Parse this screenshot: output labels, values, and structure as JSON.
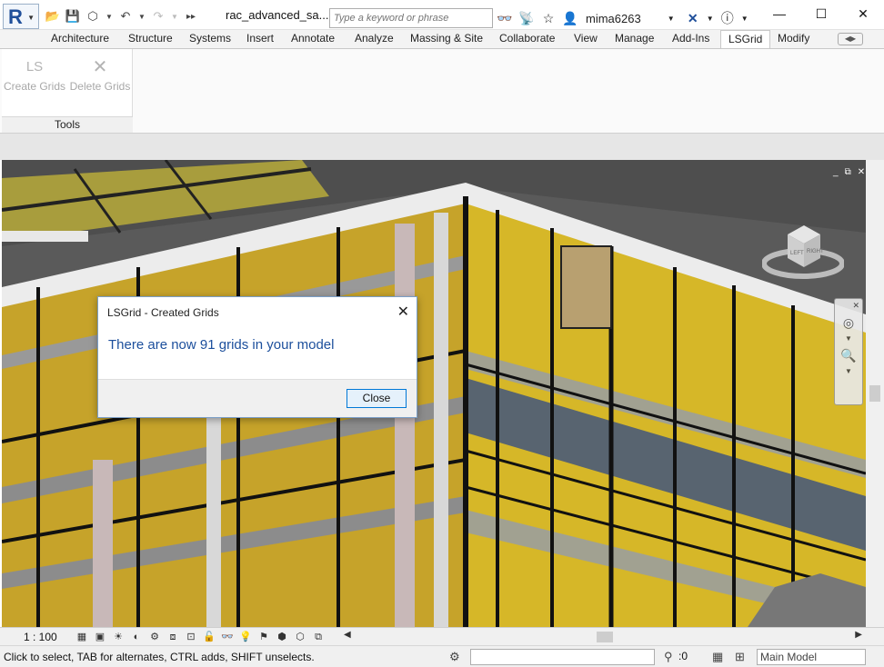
{
  "titlebar": {
    "app_letter": "R",
    "document_title": "rac_advanced_sa...",
    "search_placeholder": "Type a keyword or phrase",
    "username": "mima6263"
  },
  "ribbon": {
    "tabs": [
      "Architecture",
      "Structure",
      "Systems",
      "Insert",
      "Annotate",
      "Analyze",
      "Massing & Site",
      "Collaborate",
      "View",
      "Manage",
      "Add-Ins",
      "LSGrid",
      "Modify"
    ],
    "active_tab": "LSGrid",
    "buttons": {
      "create_grids": "Create Grids",
      "delete_grids": "Delete Grids",
      "create_grids_glyph": "LS"
    },
    "panel_label": "Tools"
  },
  "viewcube": {
    "left_face": "LEFT",
    "right_face": "RIGHT"
  },
  "dialog": {
    "title": "LSGrid - Created Grids",
    "message": "There are now 91 grids in your model",
    "close_button": "Close"
  },
  "viewbar": {
    "scale": "1 : 100"
  },
  "statusbar": {
    "message": "Click to select, TAB for alternates, CTRL adds, SHIFT unselects.",
    "filter_count": ":0",
    "model_select": "Main Model"
  },
  "colors": {
    "accent_blue": "#1c4f9c",
    "wall_yellow": "#d4b21e",
    "glass_gray": "#5a6a78"
  }
}
